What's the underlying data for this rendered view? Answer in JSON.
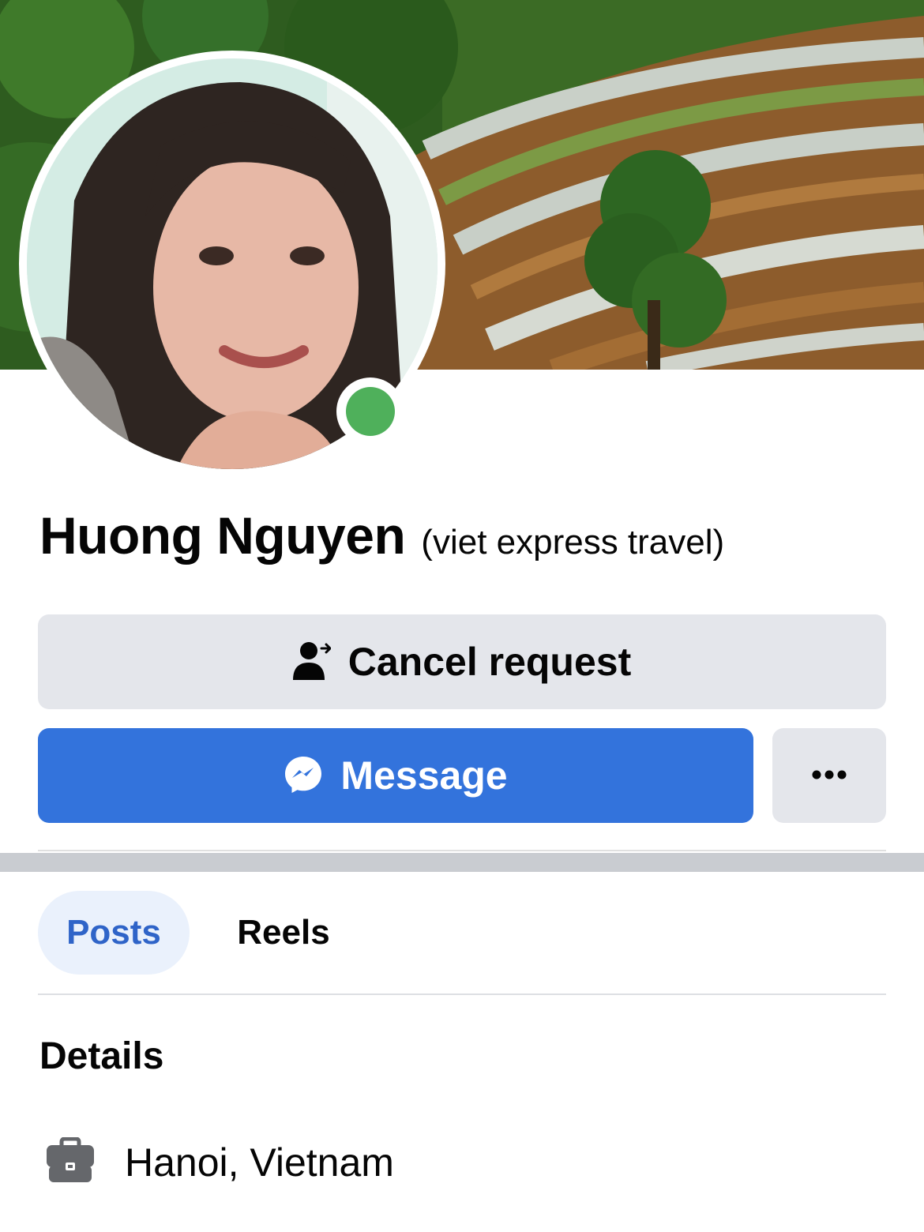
{
  "profile": {
    "name": "Huong Nguyen",
    "alternate_name": "(viet express travel)",
    "online_status_color": "#4fb05b"
  },
  "actions": {
    "cancel_request_label": "Cancel request",
    "cancel_request_icon": "person-arrow-icon",
    "message_label": "Message",
    "message_icon": "messenger-icon",
    "more_icon": "ellipsis-icon"
  },
  "tabs": [
    {
      "label": "Posts",
      "active": true
    },
    {
      "label": "Reels",
      "active": false
    }
  ],
  "details": {
    "title": "Details",
    "items": [
      {
        "icon": "briefcase-icon",
        "text": "Hanoi, Vietnam"
      }
    ]
  },
  "colors": {
    "primary_button": "#3373dc",
    "secondary_button": "#e4e6eb",
    "active_tab_bg": "#eaf1fc",
    "active_tab_text": "#2f64c8"
  }
}
